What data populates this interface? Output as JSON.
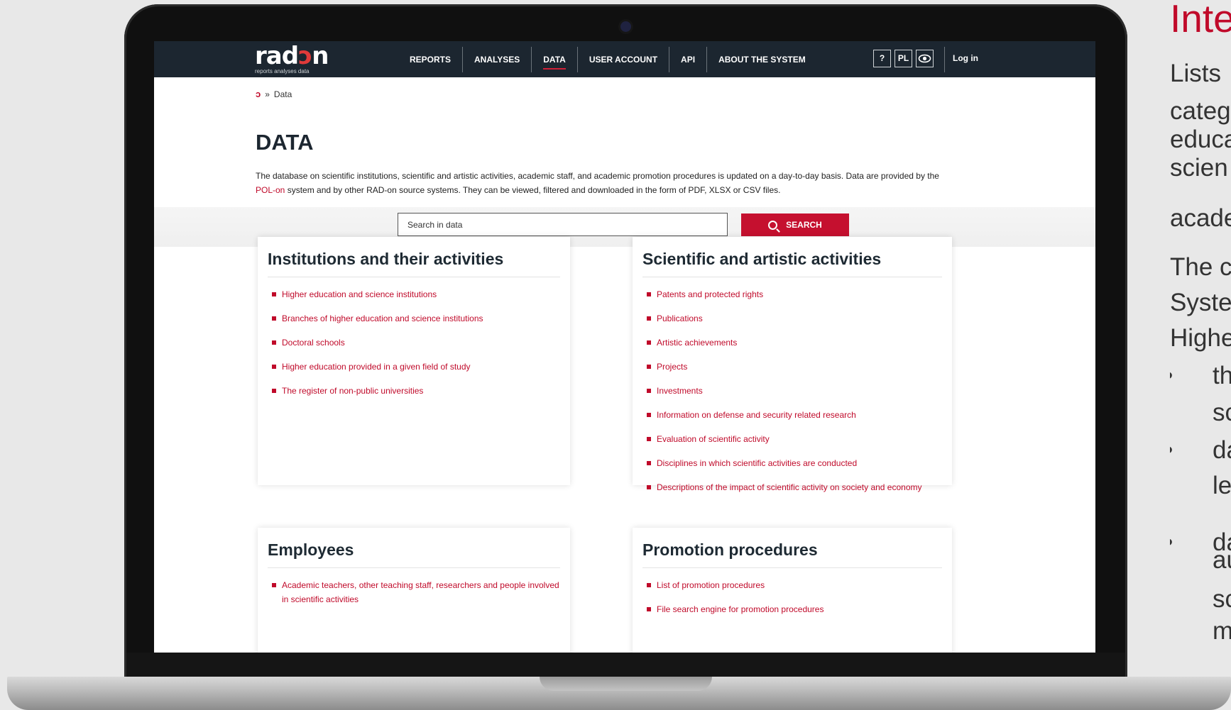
{
  "navbar": {
    "logo": {
      "part1": "rad",
      "part2": "n",
      "tagline": "reports  analyses  data"
    },
    "items": [
      {
        "label": "REPORTS",
        "active": false
      },
      {
        "label": "ANALYSES",
        "active": false
      },
      {
        "label": "DATA",
        "active": true
      },
      {
        "label": "USER ACCOUNT",
        "active": false
      },
      {
        "label": "API",
        "active": false
      },
      {
        "label": "ABOUT THE SYSTEM",
        "active": false
      }
    ],
    "tools": {
      "help": "?",
      "language": "PL"
    },
    "login": "Log in"
  },
  "breadcrumb": {
    "separator": "»",
    "current": "Data"
  },
  "page": {
    "title": "DATA",
    "intro_part1": "The database on scientific institutions, scientific and artistic activities, academic staff, and academic promotion procedures is updated on a day-to-day basis. Data are provided by the",
    "intro_link": "POL-on",
    "intro_part2": "system and by other RAD-on source systems. They can be viewed, filtered and downloaded in the form of PDF, XLSX or CSV files."
  },
  "search": {
    "placeholder": "Search in data",
    "button_label": "SEARCH"
  },
  "cards": [
    {
      "title": "Institutions and their activities",
      "items": [
        "Higher education and science institutions",
        "Branches of higher education and science institutions",
        "Doctoral schools",
        "Higher education provided in a given field of study",
        "The register of non-public universities"
      ]
    },
    {
      "title": "Scientific and artistic activities",
      "items": [
        "Patents and protected rights",
        "Publications",
        "Artistic achievements",
        "Projects",
        "Investments",
        "Information on defense and security related research",
        "Evaluation of scientific activity",
        "Disciplines in which scientific activities are conducted",
        "Descriptions of the impact of scientific activity on society and economy"
      ]
    },
    {
      "title": "Employees",
      "items": [
        "Academic teachers, other teaching staff, researchers and people involved in scientific activities"
      ]
    },
    {
      "title": "Promotion procedures",
      "items": [
        "List of promotion procedures",
        "File search engine for promotion procedures"
      ]
    }
  ],
  "side_panel": {
    "title": "Inte",
    "para1": [
      "Lists",
      "categ",
      "educa",
      "scien",
      "acade"
    ],
    "para2": [
      "The c",
      "Syste",
      "Highe"
    ],
    "bullets": [
      [
        "th",
        "sc"
      ],
      [
        "da",
        "le"
      ],
      [
        "da",
        "au",
        "sc",
        "m"
      ]
    ],
    "bullet_char": "•"
  },
  "colors": {
    "accent": "#c00a2a",
    "navbar": "#1c2630",
    "button": "#c5102f"
  }
}
